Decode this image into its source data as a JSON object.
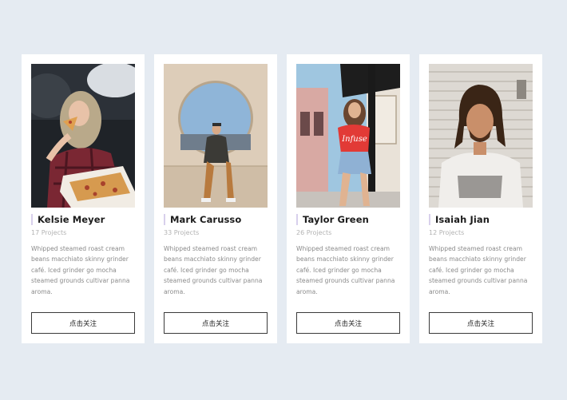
{
  "cards": [
    {
      "name": "Kelsie Meyer",
      "projects": "17 Projects",
      "description": "Whipped steamed roast cream beans macchiato skinny grinder café. Iced grinder go mocha steamed grounds cultivar panna aroma.",
      "button_label": "点击关注",
      "photo": "woman-eating-pizza-photo"
    },
    {
      "name": "Mark Carusso",
      "projects": "33 Projects",
      "description": "Whipped steamed roast cream beans macchiato skinny grinder café. Iced grinder go mocha steamed grounds cultivar panna aroma.",
      "button_label": "点击关注",
      "photo": "man-sitting-by-round-window-photo"
    },
    {
      "name": "Taylor Green",
      "projects": "26 Projects",
      "description": "Whipped steamed roast cream beans macchiato skinny grinder café. Iced grinder go mocha steamed grounds cultivar panna aroma.",
      "button_label": "点击关注",
      "photo": "woman-in-red-shirt-street-photo",
      "photo_text": "Infuse"
    },
    {
      "name": "Isaiah Jian",
      "projects": "12 Projects",
      "description": "Whipped steamed roast cream beans macchiato skinny grinder café. Iced grinder go mocha steamed grounds cultivar panna aroma.",
      "button_label": "点击关注",
      "photo": "man-with-dreadlocks-photo"
    }
  ],
  "colors": {
    "page_background": "#e5ebf2",
    "card_background": "#ffffff",
    "name_accent_bar": "#d8d0ec",
    "button_border": "#3a3a3a"
  }
}
